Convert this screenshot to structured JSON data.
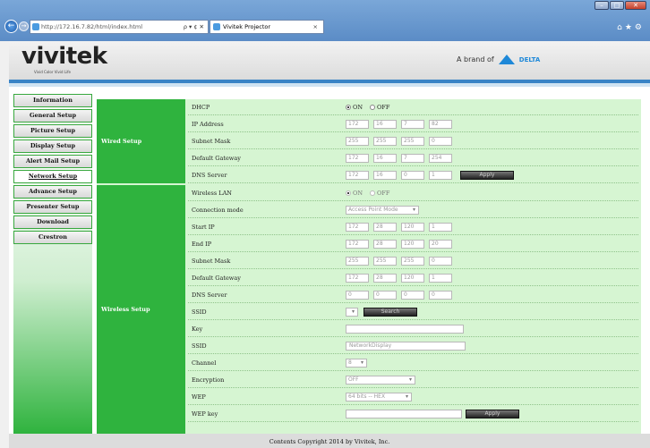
{
  "browser": {
    "address_host": "http://172.16.7.82",
    "address_path": "/html/index.html",
    "address_controls": "ρ ▾ ¢ ✕",
    "tab_title": "Vivitek Projector",
    "tab_close": "×",
    "right_icons": "⌂★⚙",
    "win_min": "–",
    "win_max": "□",
    "win_close": "✕"
  },
  "header": {
    "logo": "vivitek",
    "tagline": "Vivid Color Vivid Life",
    "brand_prefix": "A brand of",
    "brand_name": "DELTA"
  },
  "sidebar": [
    {
      "label": "Information"
    },
    {
      "label": "General Setup"
    },
    {
      "label": "Picture Setup"
    },
    {
      "label": "Display Setup"
    },
    {
      "label": "Alert Mail Setup"
    },
    {
      "label": "Network Setup"
    },
    {
      "label": "Advance Setup"
    },
    {
      "label": "Presenter Setup"
    },
    {
      "label": "Download"
    },
    {
      "label": "Crestron"
    }
  ],
  "wired": {
    "title": "Wired Setup",
    "dhcp": {
      "label": "DHCP",
      "on": "ON",
      "off": "OFF"
    },
    "ip": {
      "label": "IP Address",
      "v": [
        "172",
        "16",
        "7",
        "82"
      ]
    },
    "mask": {
      "label": "Subnet Mask",
      "v": [
        "255",
        "255",
        "255",
        "0"
      ]
    },
    "gw": {
      "label": "Default Gateway",
      "v": [
        "172",
        "16",
        "7",
        "254"
      ]
    },
    "dns": {
      "label": "DNS Server",
      "v": [
        "172",
        "16",
        "0",
        "1"
      ]
    },
    "apply": "Apply"
  },
  "wireless": {
    "title": "Wireless Setup",
    "lan": {
      "label": "Wireless LAN",
      "on": "ON",
      "off": "OFF"
    },
    "mode": {
      "label": "Connection mode",
      "value": "Access Point Mode"
    },
    "start": {
      "label": "Start IP",
      "v": [
        "172",
        "28",
        "120",
        "1"
      ]
    },
    "end": {
      "label": "End IP",
      "v": [
        "172",
        "28",
        "120",
        "20"
      ]
    },
    "mask": {
      "label": "Subnet Mask",
      "v": [
        "255",
        "255",
        "255",
        "0"
      ]
    },
    "gw": {
      "label": "Default Gateway",
      "v": [
        "172",
        "28",
        "120",
        "1"
      ]
    },
    "dns": {
      "label": "DNS Server",
      "v": [
        "0",
        "0",
        "0",
        "0"
      ]
    },
    "ssid1": {
      "label": "SSID",
      "search": "Search"
    },
    "key": {
      "label": "Key",
      "value": ""
    },
    "ssid2": {
      "label": "SSID",
      "value": "NetworkDisplay"
    },
    "channel": {
      "label": "Channel",
      "value": "8"
    },
    "enc": {
      "label": "Encryption",
      "value": "OFF"
    },
    "wep": {
      "label": "WEP",
      "value": "64 bits -- HEX"
    },
    "wepkey": {
      "label": "WEP key",
      "value": "",
      "apply": "Apply"
    }
  },
  "footer": "Contents Copyright 2014 by Vivitek, Inc.",
  "colors": {
    "green": "#2fb33e",
    "light_green": "#d6f5d2",
    "blue_stripe": "#3a84c6"
  }
}
